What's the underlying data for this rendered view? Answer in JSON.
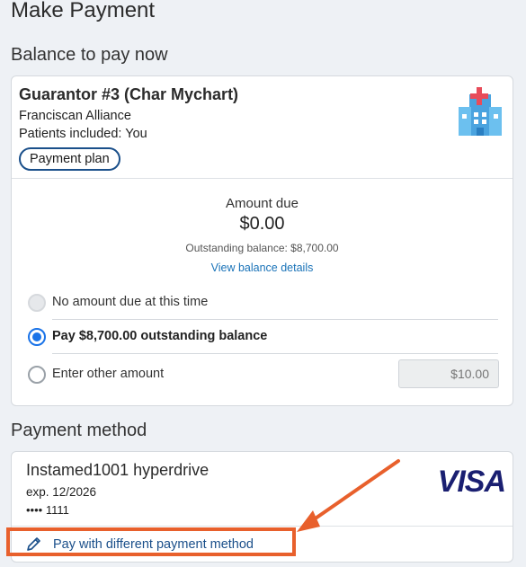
{
  "page": {
    "title": "Make Payment"
  },
  "balance_section": {
    "title": "Balance to pay now",
    "guarantor": "Guarantor #3 (Char Mychart)",
    "organization": "Franciscan Alliance",
    "patients": "Patients included: You",
    "pill": "Payment plan",
    "amount_due_label": "Amount due",
    "amount_due": "$0.00",
    "outstanding": "Outstanding balance: $8,700.00",
    "details_link": "View balance details",
    "options": [
      {
        "label": "No amount due at this time",
        "state": "disabled"
      },
      {
        "label": "Pay $8,700.00 outstanding balance",
        "state": "selected"
      },
      {
        "label": "Enter other amount",
        "state": "unselected"
      }
    ],
    "other_amount_placeholder": "$10.00"
  },
  "payment_method": {
    "title": "Payment method",
    "name": "Instamed1001 hyperdrive",
    "expiration": "exp. 12/2026",
    "number": "•••• 1111",
    "brand": "VISA",
    "change_link": "Pay with different payment method"
  },
  "colors": {
    "link": "#1a73b8",
    "accent": "#1a73e8",
    "annotation": "#e8602c",
    "visa": "#1a1f71"
  }
}
